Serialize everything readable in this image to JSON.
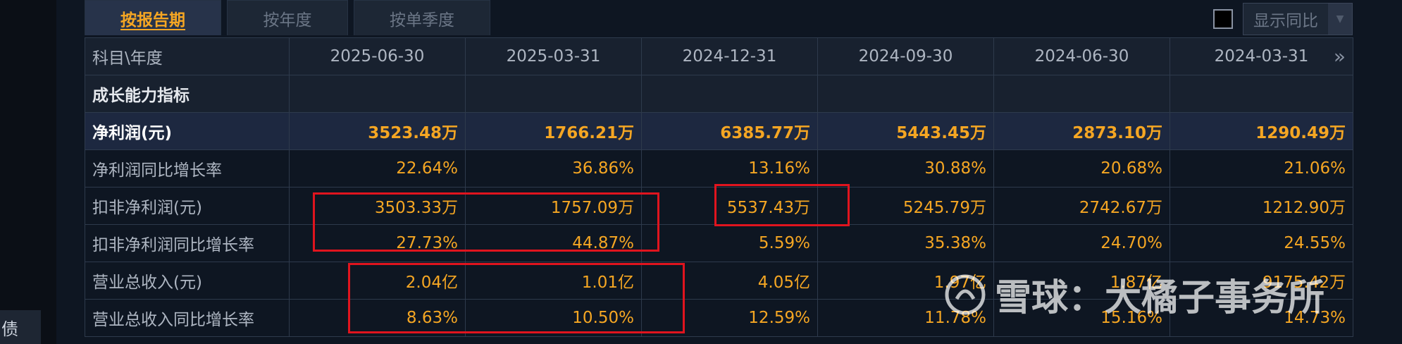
{
  "side_tab": "债",
  "tabs": [
    {
      "label": "按报告期",
      "active": true
    },
    {
      "label": "按年度",
      "active": false
    },
    {
      "label": "按单季度",
      "active": false
    }
  ],
  "yoy_toggle": {
    "label": "显示同比",
    "checked": false
  },
  "table": {
    "header": [
      "科目\\年度",
      "2025-06-30",
      "2025-03-31",
      "2024-12-31",
      "2024-09-30",
      "2024-06-30",
      "2024-03-31"
    ],
    "rows": [
      {
        "label": "成长能力指标",
        "style": "section",
        "cells": [
          "",
          "",
          "",
          "",
          "",
          ""
        ]
      },
      {
        "label": "净利润(元)",
        "style": "bold",
        "cells": [
          "3523.48万",
          "1766.21万",
          "6385.77万",
          "5443.45万",
          "2873.10万",
          "1290.49万"
        ]
      },
      {
        "label": "净利润同比增长率",
        "style": "normal",
        "cells": [
          "22.64%",
          "36.86%",
          "13.16%",
          "30.88%",
          "20.68%",
          "21.06%"
        ]
      },
      {
        "label": "扣非净利润(元)",
        "style": "normal",
        "cells": [
          "3503.33万",
          "1757.09万",
          "5537.43万",
          "5245.79万",
          "2742.67万",
          "1212.90万"
        ]
      },
      {
        "label": "扣非净利润同比增长率",
        "style": "normal",
        "cells": [
          "27.73%",
          "44.87%",
          "5.59%",
          "35.38%",
          "24.70%",
          "24.55%"
        ]
      },
      {
        "label": "营业总收入(元)",
        "style": "normal",
        "cells": [
          "2.04亿",
          "1.01亿",
          "4.05亿",
          "1.97亿",
          "1.87亿",
          "9175.42万"
        ]
      },
      {
        "label": "营业总收入同比增长率",
        "style": "normal",
        "cells": [
          "8.63%",
          "10.50%",
          "12.59%",
          "11.78%",
          "15.16%",
          "14.73%"
        ]
      }
    ]
  },
  "watermark": "雪球：大橘子事务所",
  "colors": {
    "accent": "#f5a623",
    "highlight_box": "#e0141e",
    "background": "#0e1622"
  }
}
